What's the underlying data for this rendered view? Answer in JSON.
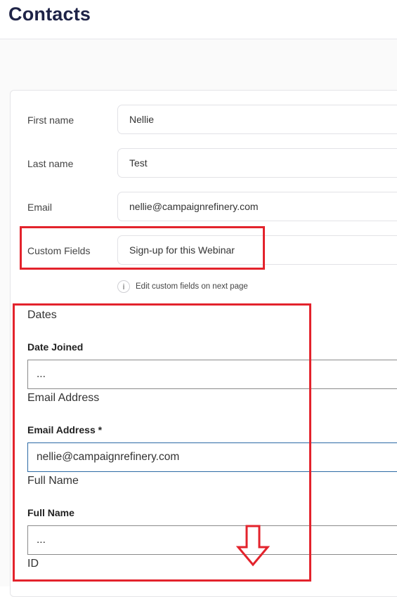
{
  "header": {
    "title": "Contacts"
  },
  "form": {
    "first_name": {
      "label": "First name",
      "value": "Nellie"
    },
    "last_name": {
      "label": "Last name",
      "value": "Test"
    },
    "email": {
      "label": "Email",
      "value": "nellie@campaignrefinery.com"
    },
    "custom_fields": {
      "label": "Custom Fields",
      "value": "Sign-up for this Webinar"
    },
    "hint": "Edit custom fields on next page"
  },
  "custom_section": {
    "dates": {
      "heading": "Dates",
      "label": "Date Joined",
      "value": "..."
    },
    "email_address": {
      "heading": "Email Address",
      "label": "Email Address *",
      "value": "nellie@campaignrefinery.com"
    },
    "full_name": {
      "heading": "Full Name",
      "label": "Full Name",
      "value": "..."
    },
    "id": {
      "heading": "ID"
    }
  },
  "icons": {
    "info": "info-icon",
    "arrow": "down-arrow-icon"
  },
  "colors": {
    "title": "#1e2347",
    "annotation": "#e3232c",
    "focus": "#2c6aa5"
  }
}
